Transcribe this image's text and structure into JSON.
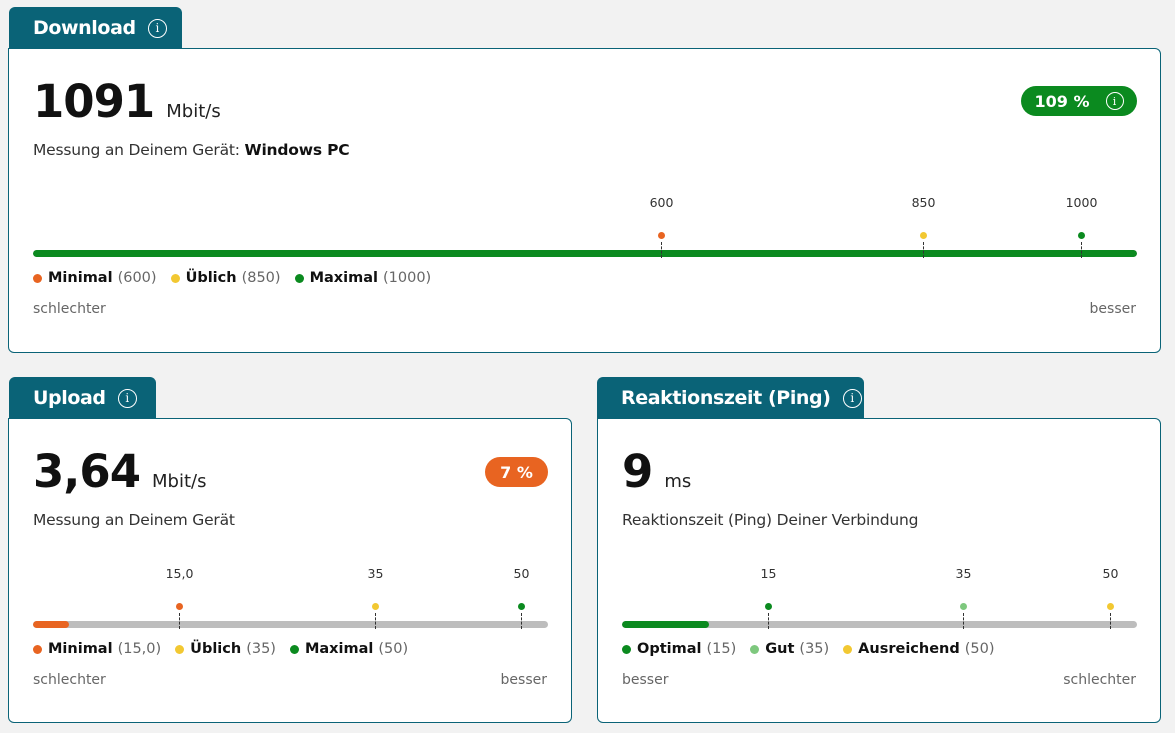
{
  "colors": {
    "teal": "#0a6377",
    "green": "#0b8a1f",
    "orange": "#e86421",
    "yellow": "#f2c832",
    "lightgreen": "#7ec87e"
  },
  "download": {
    "title": "Download",
    "value": "1091",
    "unit": "Mbit/s",
    "desc_prefix": "Messung an Deinem Gerät:",
    "desc_device": "Windows PC",
    "percent": "109 %",
    "fill_fraction": 1.0,
    "ticks": [
      "600",
      "850",
      "1000"
    ],
    "legend": [
      {
        "name": "Minimal",
        "value": "(600)"
      },
      {
        "name": "Üblich",
        "value": "(850)"
      },
      {
        "name": "Maximal",
        "value": "(1000)"
      }
    ],
    "left_label": "schlechter",
    "right_label": "besser"
  },
  "upload": {
    "title": "Upload",
    "value": "3,64",
    "unit": "Mbit/s",
    "desc": "Messung an Deinem Gerät",
    "percent": "7 %",
    "fill_fraction": 0.07,
    "ticks": [
      "15,0",
      "35",
      "50"
    ],
    "legend": [
      {
        "name": "Minimal",
        "value": "(15,0)"
      },
      {
        "name": "Üblich",
        "value": "(35)"
      },
      {
        "name": "Maximal",
        "value": "(50)"
      }
    ],
    "left_label": "schlechter",
    "right_label": "besser"
  },
  "ping": {
    "title": "Reaktionszeit (Ping)",
    "value": "9",
    "unit": "ms",
    "desc": "Reaktionszeit (Ping) Deiner Verbindung",
    "ticks": [
      "15",
      "35",
      "50"
    ],
    "legend": [
      {
        "name": "Optimal",
        "value": "(15)"
      },
      {
        "name": "Gut",
        "value": "(35)"
      },
      {
        "name": "Ausreichend",
        "value": "(50)"
      }
    ],
    "left_label": "besser",
    "right_label": "schlechter"
  }
}
